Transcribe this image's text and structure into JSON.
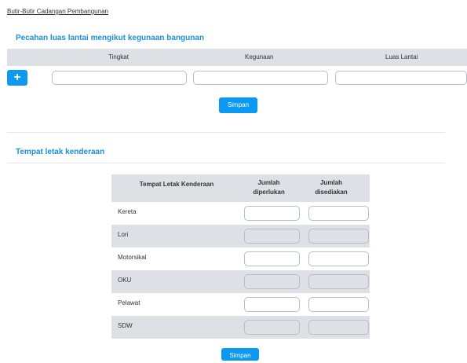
{
  "breadcrumb": "Butir-Butir Cadangan Pembangunan",
  "section1": {
    "title": "Pecahan luas lantai mengikut kegunaan bangunan",
    "columns": [
      "Tingkat",
      "Kegunaan",
      "Luas Lantai"
    ],
    "add_icon": "plus-icon",
    "add_label": "+",
    "save_label": "Simpan"
  },
  "section2": {
    "title": "Tempat letak kenderaan",
    "columns": [
      "Tempat Letak Kenderaan",
      "Jumlah diperlukan",
      "Jumlah disediakan"
    ],
    "rows": [
      {
        "label": "Kereta",
        "editable": true
      },
      {
        "label": "Lori",
        "editable": false
      },
      {
        "label": "Motorsikal",
        "editable": true
      },
      {
        "label": "OKU",
        "editable": false
      },
      {
        "label": "Pelawat",
        "editable": true
      },
      {
        "label": "SDW",
        "editable": false
      }
    ],
    "save_label": "Simpan"
  },
  "colors": {
    "accent": "#0d99f2",
    "title": "#1a8fd8",
    "row_alt": "#dde1e6"
  }
}
